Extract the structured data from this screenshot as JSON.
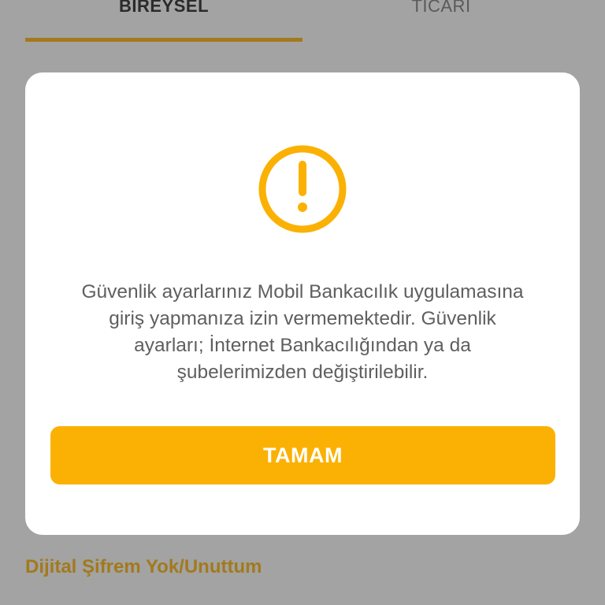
{
  "tabs": {
    "individual_label": "BİREYSEL",
    "commercial_label": "TİCARİ"
  },
  "dialog": {
    "icon": "warning-circle-icon",
    "message": "Güvenlik ayarlarınız Mobil Bankacılık uygulamasına\ngiriş yapmanıza izin vermemektedir. Güvenlik\nayarları; İnternet Bankacılığından ya da\nşubelerimizden değiştirilebilir.",
    "ok_label": "TAMAM"
  },
  "footer": {
    "forgot_link_label": "Dijital Şifrem Yok/Unuttum"
  },
  "colors": {
    "accent": "#fbb103",
    "tab_indicator": "#a27a1c",
    "overlay_bg": "#a3a3a3",
    "dialog_bg": "#ffffff",
    "message_text": "#5f5f5f",
    "link_text": "#a27a1c"
  }
}
